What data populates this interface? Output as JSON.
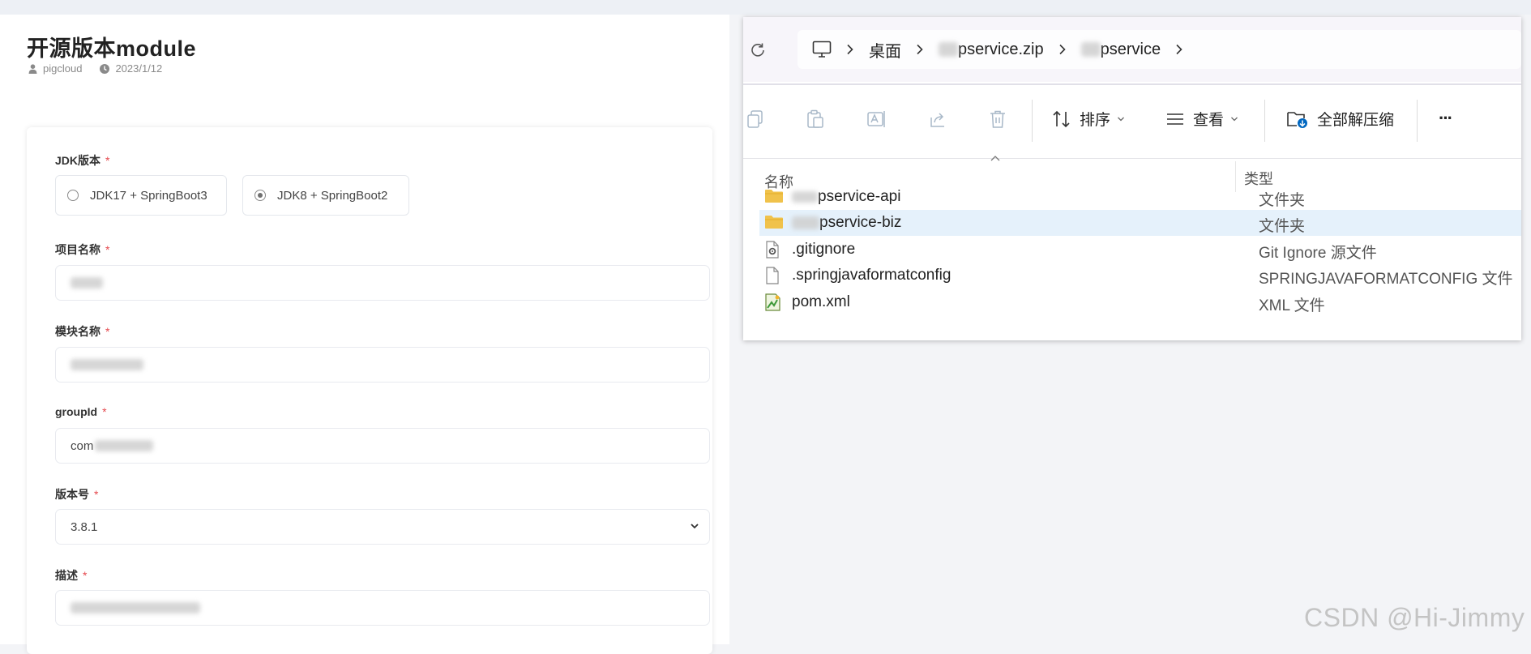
{
  "page": {
    "title": "开源版本module",
    "author": "pigcloud",
    "date": "2023/1/12"
  },
  "form": {
    "jdk": {
      "label": "JDK版本",
      "options": [
        {
          "label": "JDK17 + SpringBoot3",
          "selected": false
        },
        {
          "label": "JDK8 + SpringBoot2",
          "selected": true
        }
      ]
    },
    "project_name": {
      "label": "项目名称"
    },
    "module_name": {
      "label": "模块名称"
    },
    "group_id": {
      "label": "groupId",
      "value": "com"
    },
    "version": {
      "label": "版本号",
      "value": "3.8.1"
    },
    "description": {
      "label": "描述"
    },
    "required_mark": "*"
  },
  "explorer": {
    "breadcrumb": [
      "桌面",
      "pservice.zip",
      "pservice"
    ],
    "toolbar": {
      "sort_label": "排序",
      "view_label": "查看",
      "extract_label": "全部解压缩",
      "more_label": "···"
    },
    "columns": {
      "name": "名称",
      "type": "类型"
    },
    "files": [
      {
        "name": "pservice-api",
        "type": "文件夹",
        "icon": "folder-icon",
        "selected": false
      },
      {
        "name": "pservice-biz",
        "type": "文件夹",
        "icon": "folder-icon",
        "selected": true
      },
      {
        "name": ".gitignore",
        "type": "Git Ignore 源文件",
        "icon": "gear-file-icon",
        "selected": false
      },
      {
        "name": ".springjavaformatconfig",
        "type": "SPRINGJAVAFORMATCONFIG 文件",
        "icon": "file-icon",
        "selected": false
      },
      {
        "name": "pom.xml",
        "type": "XML 文件",
        "icon": "xml-file-icon",
        "selected": false
      }
    ]
  },
  "watermark": "CSDN @Hi-Jimmy",
  "colors": {
    "required": "#e5484d",
    "selected_row": "#e5f1fb",
    "accent": "#0067c0"
  }
}
